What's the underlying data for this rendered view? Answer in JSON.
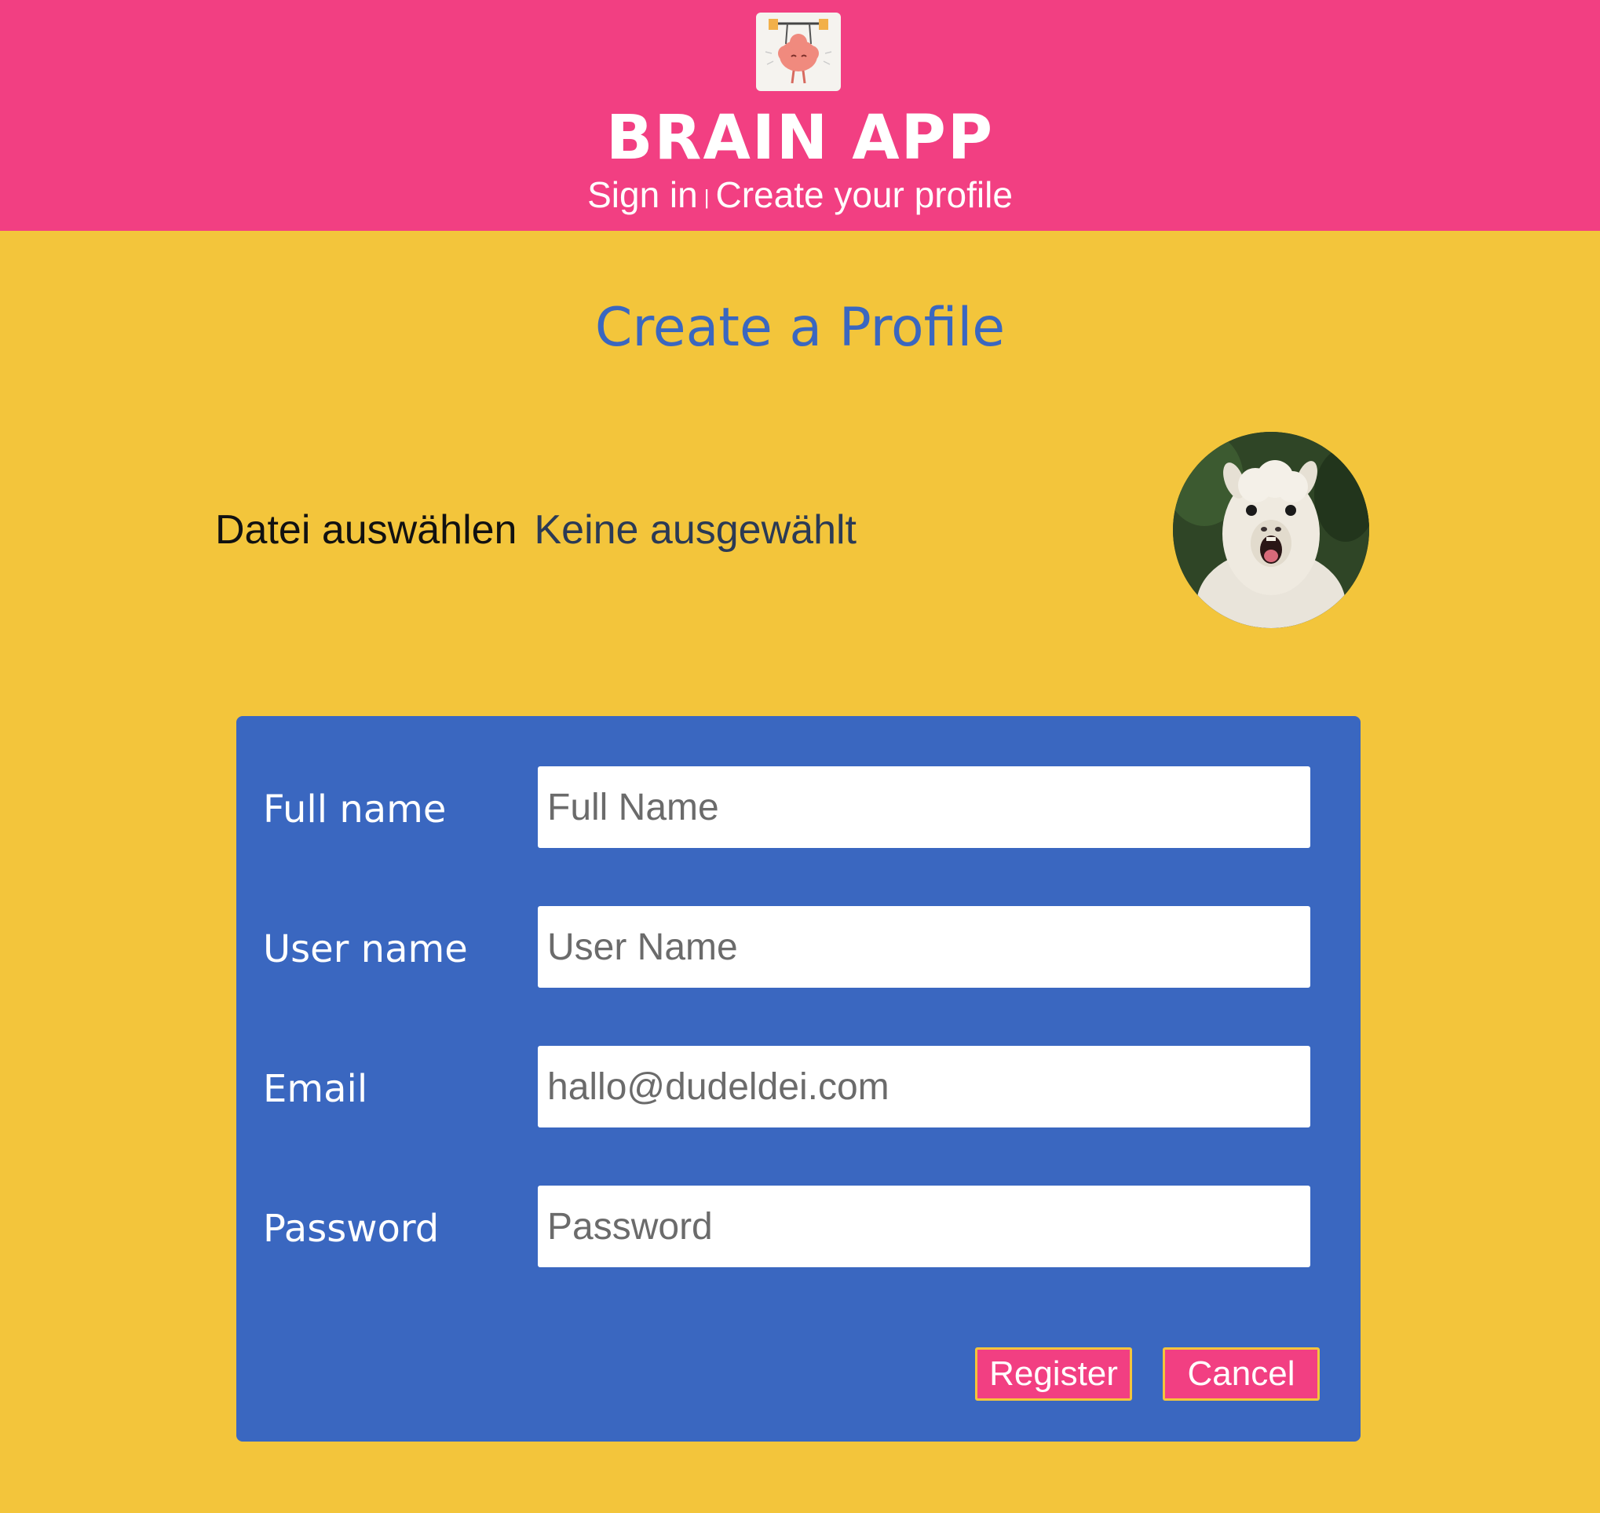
{
  "header": {
    "logo_icon": "brain-lifting-weights-logo",
    "title": "BRAIN APP",
    "nav": {
      "sign_in": "Sign in",
      "separator": "|",
      "create_profile": "Create your profile"
    }
  },
  "main": {
    "title": "Create a Profile",
    "file_picker": {
      "button_label": "Datei auswählen",
      "status": "Keine ausgewählt"
    },
    "avatar_icon": "alpaca-profile-photo"
  },
  "form": {
    "fields": [
      {
        "label": "Full name",
        "placeholder": "Full Name",
        "value": ""
      },
      {
        "label": "User name",
        "placeholder": "User Name",
        "value": ""
      },
      {
        "label": "Email",
        "placeholder": "hallo@dudeldei.com",
        "value": ""
      },
      {
        "label": "Password",
        "placeholder": "Password",
        "value": ""
      }
    ],
    "register_label": "Register",
    "cancel_label": "Cancel"
  },
  "colors": {
    "header_bg": "#f23f82",
    "page_bg": "#f3c53b",
    "panel_bg": "#3a67c0",
    "title_color": "#3a67c0",
    "button_bg": "#f23f82"
  }
}
